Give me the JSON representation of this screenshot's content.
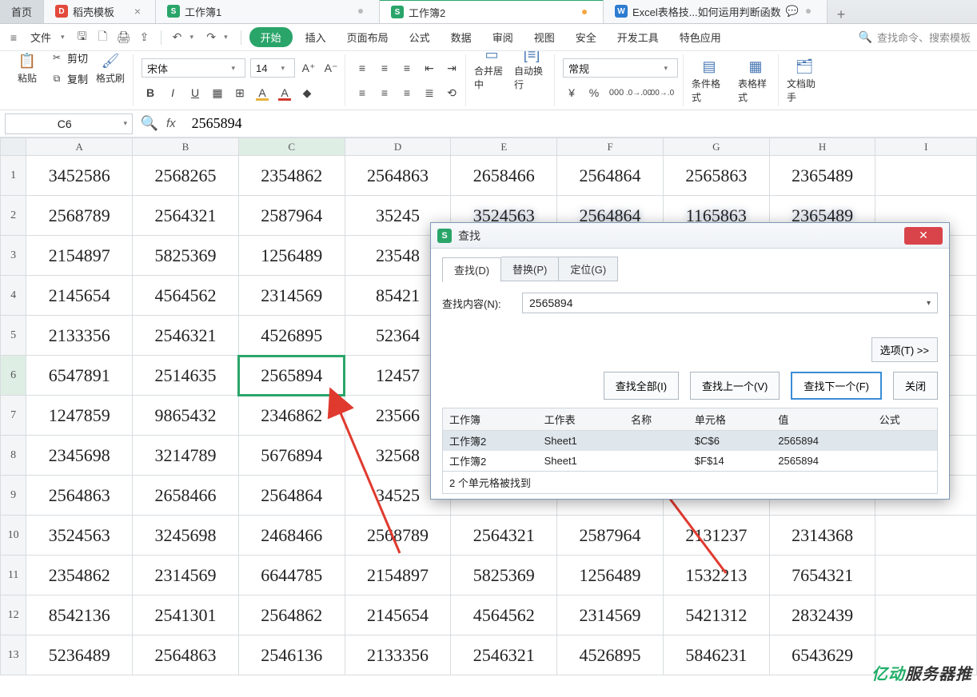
{
  "tabs": {
    "home": "首页",
    "t1": "稻壳模板",
    "t2": "工作簿1",
    "t3": "工作簿2",
    "t4": "Excel表格技...如何运用判断函数"
  },
  "menu": {
    "file": "文件",
    "start": "开始",
    "insert": "插入",
    "pagelayout": "页面布局",
    "formula": "公式",
    "data": "数据",
    "review": "审阅",
    "view": "视图",
    "security": "安全",
    "dev": "开发工具",
    "special": "特色应用",
    "search_placeholder": "查找命令、搜索模板"
  },
  "ribbon": {
    "paste": "粘贴",
    "cut": "剪切",
    "copy": "复制",
    "fmtpaint": "格式刷",
    "font_name": "宋体",
    "font_size": "14",
    "merge": "合并居中",
    "wrap": "自动换行",
    "currency": "常规",
    "condfmt": "条件格式",
    "tblstyle": "表格样式",
    "docass": "文档助手"
  },
  "namebox": "C6",
  "formula": "2565894",
  "cols": [
    "A",
    "B",
    "C",
    "D",
    "E",
    "F",
    "G",
    "H",
    "I"
  ],
  "rows": [
    "1",
    "2",
    "3",
    "4",
    "5",
    "6",
    "7",
    "8",
    "9",
    "10",
    "11",
    "12",
    "13"
  ],
  "sheet": [
    [
      "3452586",
      "2568265",
      "2354862",
      "2564863",
      "2658466",
      "2564864",
      "2565863",
      "2365489",
      ""
    ],
    [
      "2568789",
      "2564321",
      "2587964",
      "35245",
      "",
      "",
      "",
      "",
      ""
    ],
    [
      "2154897",
      "5825369",
      "1256489",
      "23548",
      "",
      "",
      "",
      "",
      ""
    ],
    [
      "2145654",
      "4564562",
      "2314569",
      "85421",
      "",
      "",
      "",
      "",
      ""
    ],
    [
      "2133356",
      "2546321",
      "4526895",
      "52364",
      "",
      "",
      "",
      "",
      ""
    ],
    [
      "6547891",
      "2514635",
      "2565894",
      "12457",
      "",
      "",
      "",
      "",
      ""
    ],
    [
      "1247859",
      "9865432",
      "2346862",
      "23566",
      "",
      "",
      "",
      "",
      ""
    ],
    [
      "2345698",
      "3214789",
      "5676894",
      "32568",
      "",
      "",
      "",
      "",
      ""
    ],
    [
      "2564863",
      "2658466",
      "2564864",
      "34525",
      "",
      "",
      "",
      "",
      ""
    ],
    [
      "3524563",
      "3245698",
      "2468466",
      "2568789",
      "2564321",
      "2587964",
      "2131237",
      "2314368",
      ""
    ],
    [
      "2354862",
      "2314569",
      "6644785",
      "2154897",
      "5825369",
      "1256489",
      "1532213",
      "7654321",
      ""
    ],
    [
      "8542136",
      "2541301",
      "2564862",
      "2145654",
      "4564562",
      "2314569",
      "5421312",
      "2832439",
      ""
    ],
    [
      "5236489",
      "2564863",
      "2546136",
      "2133356",
      "2546321",
      "4526895",
      "5846231",
      "6543629",
      ""
    ]
  ],
  "blur_row2": [
    "3524563",
    "2564864",
    "1165863",
    "2365489"
  ],
  "dialog": {
    "title": "查找",
    "tab_find": "查找(D)",
    "tab_replace": "替换(P)",
    "tab_goto": "定位(G)",
    "lbl_content": "查找内容(N):",
    "value": "2565894",
    "options": "选项(T) >>",
    "find_all": "查找全部(I)",
    "find_prev": "查找上一个(V)",
    "find_next": "查找下一个(F)",
    "close": "关闭",
    "cols": {
      "wb": "工作簿",
      "ws": "工作表",
      "nm": "名称",
      "cell": "单元格",
      "val": "值",
      "fml": "公式"
    },
    "results": [
      {
        "wb": "工作簿2",
        "ws": "Sheet1",
        "nm": "",
        "cell": "$C$6",
        "val": "2565894",
        "fml": ""
      },
      {
        "wb": "工作簿2",
        "ws": "Sheet1",
        "nm": "",
        "cell": "$F$14",
        "val": "2565894",
        "fml": ""
      }
    ],
    "footer": "2 个单元格被找到"
  },
  "watermark1": "亿动",
  "watermark2": "服务器推"
}
